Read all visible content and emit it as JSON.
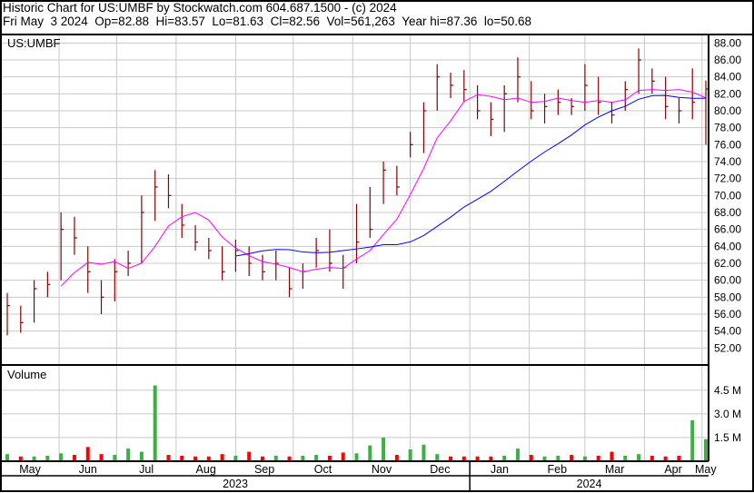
{
  "header": {
    "title": "Historic Chart for US:UMBF by Stockwatch.com 604.687.1500 - (c) 2024",
    "quote": "Fri May  3 2024  Op=82.88  Hi=83.57  Lo=81.63  Cl=82.56  Vol=561,263  Year hi=87.36  lo=50.68"
  },
  "colors": {
    "bar": "#8b0000",
    "ma_short": "#ff00ff",
    "ma_long": "#0000ff",
    "vol_up": "#3cb043",
    "vol_down": "#ff0000",
    "grid": "#c8c8c8"
  },
  "chart_data": {
    "type": "ohlc-bar",
    "symbol_label": "US:UMBF",
    "volume_label": "Volume",
    "start_date": "2023-05-05",
    "interval_days": 7,
    "ma_periods": [
      5,
      18
    ],
    "price_ylim": [
      50,
      89
    ],
    "price_ticks": [
      "52.00",
      "54.00",
      "56.00",
      "58.00",
      "60.00",
      "62.00",
      "64.00",
      "66.00",
      "68.00",
      "70.00",
      "72.00",
      "74.00",
      "76.00",
      "78.00",
      "80.00",
      "82.00",
      "84.00",
      "86.00",
      "88.00"
    ],
    "volume_ylim": [
      0,
      6.1
    ],
    "volume_ticks": [
      {
        "v": 1.5,
        "label": "1.5 M"
      },
      {
        "v": 3.0,
        "label": "3.0 M"
      },
      {
        "v": 4.5,
        "label": "4.5 M"
      }
    ],
    "months": [
      {
        "label": "May",
        "date": "2023-05-01"
      },
      {
        "label": "Jun",
        "date": "2023-06-01"
      },
      {
        "label": "Jul",
        "date": "2023-07-01"
      },
      {
        "label": "Aug",
        "date": "2023-08-01"
      },
      {
        "label": "Sep",
        "date": "2023-09-01"
      },
      {
        "label": "Oct",
        "date": "2023-10-01"
      },
      {
        "label": "Nov",
        "date": "2023-11-01"
      },
      {
        "label": "Dec",
        "date": "2023-12-01"
      },
      {
        "label": "Jan",
        "date": "2024-01-01"
      },
      {
        "label": "Feb",
        "date": "2024-02-01"
      },
      {
        "label": "Mar",
        "date": "2024-03-01"
      },
      {
        "label": "Apr",
        "date": "2024-04-01"
      },
      {
        "label": "May",
        "date": "2024-05-01"
      }
    ],
    "years": [
      {
        "label": "2023",
        "from": "2023-05-01",
        "to": "2024-01-01"
      },
      {
        "label": "2024",
        "from": "2024-01-01",
        "to": "2024-05-06"
      }
    ],
    "bars": [
      [
        57,
        58.5,
        53.5
      ],
      [
        55,
        57,
        53.8
      ],
      [
        59,
        60,
        55
      ],
      [
        59.5,
        61,
        58
      ],
      [
        66,
        68,
        60
      ],
      [
        65,
        67.5,
        63
      ],
      [
        61,
        64,
        58.5
      ],
      [
        58,
        60,
        56
      ],
      [
        61,
        62.5,
        57.5
      ],
      [
        62,
        63.5,
        60.5
      ],
      [
        68,
        70,
        62
      ],
      [
        71,
        73,
        67
      ],
      [
        70,
        72.5,
        68.5
      ],
      [
        66.5,
        69,
        65
      ],
      [
        64.5,
        66.5,
        63.5
      ],
      [
        63.5,
        65,
        62.5
      ],
      [
        61,
        64,
        60
      ],
      [
        63.5,
        64.8,
        61
      ],
      [
        62,
        64,
        60.5
      ],
      [
        61,
        63,
        60
      ],
      [
        62,
        63.5,
        60
      ],
      [
        59,
        61.5,
        58
      ],
      [
        61,
        62,
        59
      ],
      [
        63.5,
        65,
        61.5
      ],
      [
        62,
        66,
        61
      ],
      [
        61.5,
        63,
        59
      ],
      [
        64.5,
        69,
        62
      ],
      [
        66,
        71,
        65
      ],
      [
        73,
        74,
        69
      ],
      [
        71,
        73.5,
        70
      ],
      [
        76,
        77.5,
        74.5
      ],
      [
        80,
        81,
        75
      ],
      [
        84,
        85.5,
        80
      ],
      [
        83,
        84.5,
        81.5
      ],
      [
        82.5,
        84.8,
        81
      ],
      [
        80,
        83,
        79
      ],
      [
        79,
        81,
        77
      ],
      [
        82,
        83,
        77.5
      ],
      [
        84,
        86.3,
        81
      ],
      [
        80,
        83.5,
        79
      ],
      [
        80.5,
        82,
        78.5
      ],
      [
        81,
        82.5,
        79.5
      ],
      [
        80.5,
        81.5,
        79.5
      ],
      [
        83,
        85.5,
        80
      ],
      [
        81,
        84,
        79.5
      ],
      [
        79.5,
        81,
        78.5
      ],
      [
        82.5,
        83.5,
        80
      ],
      [
        86,
        87.36,
        82
      ],
      [
        83.5,
        85,
        82
      ],
      [
        80.5,
        84,
        79
      ],
      [
        80,
        81.5,
        78.5
      ],
      [
        81,
        85,
        79
      ],
      [
        82.56,
        83.57,
        76
      ]
    ],
    "volume_millions": [
      0.45,
      0.3,
      0.3,
      0.35,
      0.5,
      0.4,
      0.9,
      0.45,
      0.4,
      0.8,
      0.6,
      4.8,
      0.4,
      0.35,
      0.3,
      0.3,
      0.45,
      0.35,
      0.6,
      0.3,
      0.35,
      0.3,
      0.35,
      0.4,
      0.35,
      0.55,
      0.5,
      1.0,
      1.5,
      0.4,
      0.75,
      1.05,
      0.45,
      0.3,
      0.3,
      0.3,
      0.3,
      0.35,
      0.8,
      0.4,
      0.3,
      0.35,
      0.4,
      0.3,
      0.35,
      0.6,
      0.35,
      0.45,
      0.35,
      0.3,
      0.35,
      2.6,
      1.4
    ]
  }
}
